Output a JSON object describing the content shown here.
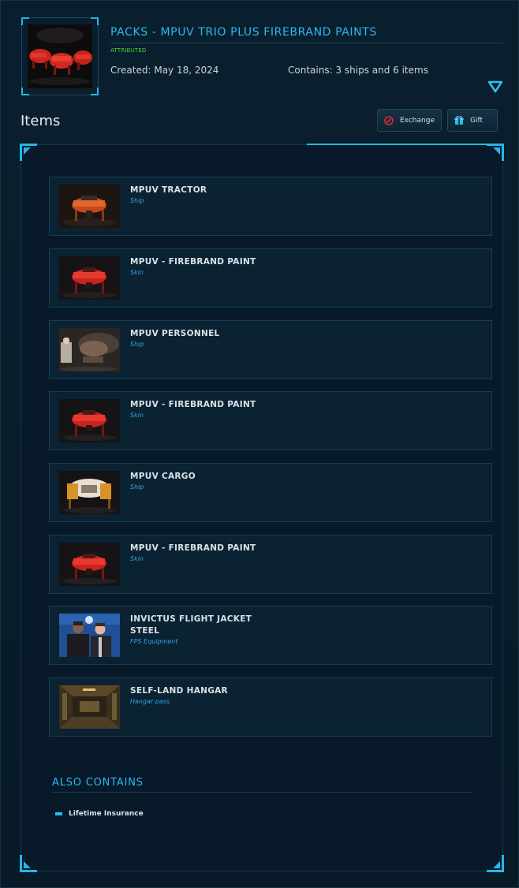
{
  "pack": {
    "title": "PACKS - MPUV TRIO PLUS FIREBRAND PAINTS",
    "status": "ATTRIBUTED",
    "created": "Created: May 18, 2024",
    "contains": "Contains: 3 ships and 6 items",
    "image_icon": "pack-thumbnail"
  },
  "items_section": {
    "heading": "Items",
    "exchange_label": "Exchange",
    "gift_label": "Gift"
  },
  "items": [
    {
      "name": "MPUV TRACTOR",
      "type": "Ship",
      "image": "ship-tractor"
    },
    {
      "name": "MPUV - FIREBRAND PAINT",
      "type": "Skin",
      "image": "ship-firebrand"
    },
    {
      "name": "MPUV PERSONNEL",
      "type": "Ship",
      "image": "ship-personnel"
    },
    {
      "name": "MPUV - FIREBRAND PAINT",
      "type": "Skin",
      "image": "ship-firebrand"
    },
    {
      "name": "MPUV CARGO",
      "type": "Ship",
      "image": "ship-cargo"
    },
    {
      "name": "MPUV - FIREBRAND PAINT",
      "type": "Skin",
      "image": "ship-firebrand"
    },
    {
      "name": "INVICTUS FLIGHT JACKET STEEL",
      "type": "FPS Equipment",
      "image": "jacket-people"
    },
    {
      "name": "SELF-LAND HANGAR",
      "type": "Hangar pass",
      "image": "hangar-interior"
    }
  ],
  "also_contains": {
    "heading": "ALSO CONTAINS",
    "items": [
      "Lifetime Insurance"
    ]
  },
  "colors": {
    "accent": "#2bb9ee",
    "status_green": "#4cd92e",
    "background": "#071826"
  }
}
